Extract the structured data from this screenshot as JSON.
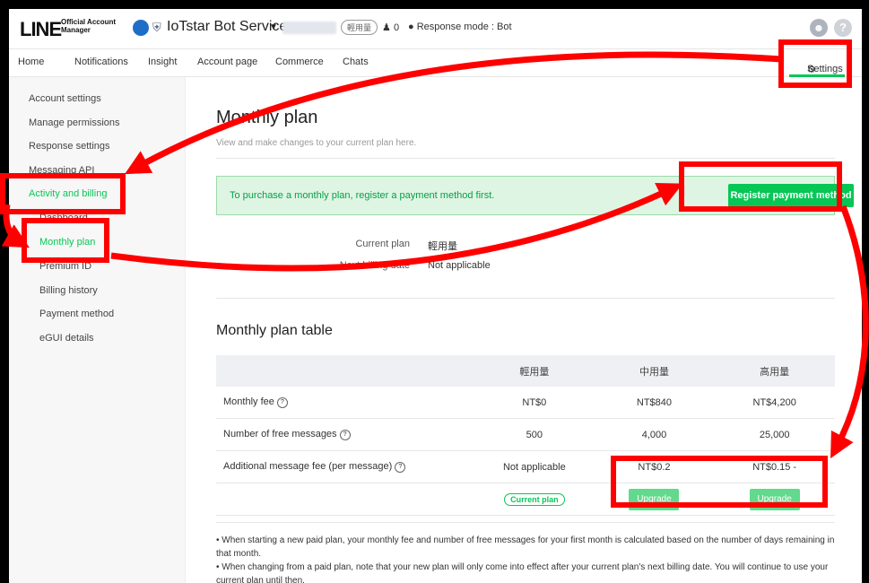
{
  "header": {
    "logo_main": "LINE",
    "logo_sub_1": "Official Account",
    "logo_sub_2": "Manager",
    "account_name": "IoTstar Bot Service",
    "plan_badge": "輕用量",
    "friends_count": "0",
    "response_mode": "Response mode : Bot"
  },
  "nav": {
    "items": [
      "Home",
      "Notifications",
      "Insight",
      "Account page",
      "Commerce",
      "Chats"
    ],
    "settings": "Settings"
  },
  "sidebar": {
    "items": [
      "Account settings",
      "Manage permissions",
      "Response settings",
      "Messaging API",
      "Activity and billing",
      "Dashboard",
      "Monthly plan",
      "Premium ID",
      "Billing history",
      "Payment method",
      "eGUI details"
    ]
  },
  "main": {
    "title": "Monthly plan",
    "subtitle": "View and make changes to your current plan here.",
    "alert_text": "To purchase a monthly plan, register a payment method first.",
    "register_button": "Register payment method",
    "current_plan_label": "Current plan",
    "current_plan_value": "輕用量",
    "next_billing_label": "Next billing date",
    "next_billing_value": "Not applicable",
    "table_title": "Monthly plan table",
    "table": {
      "headers": [
        "",
        "輕用量",
        "中用量",
        "高用量"
      ],
      "rows": [
        [
          "Monthly fee",
          "NT$0",
          "NT$840",
          "NT$4,200"
        ],
        [
          "Number of free messages",
          "500",
          "4,000",
          "25,000"
        ],
        [
          "Additional message fee (per message)",
          "Not applicable",
          "NT$0.2",
          "NT$0.15 -"
        ]
      ],
      "current_plan_badge": "Current plan",
      "upgrade_label": "Upgrade"
    },
    "note_1": "• When starting a new paid plan, your monthly fee and number of free messages for your first month is calculated based on the number of days remaining in that month.",
    "note_2": "• When changing from a paid plan, note that your new plan will only come into effect after your current plan's next billing date. You will continue to use your current plan until then."
  },
  "colors": {
    "brand_green": "#06c755",
    "annotation_red": "#ff0000"
  }
}
